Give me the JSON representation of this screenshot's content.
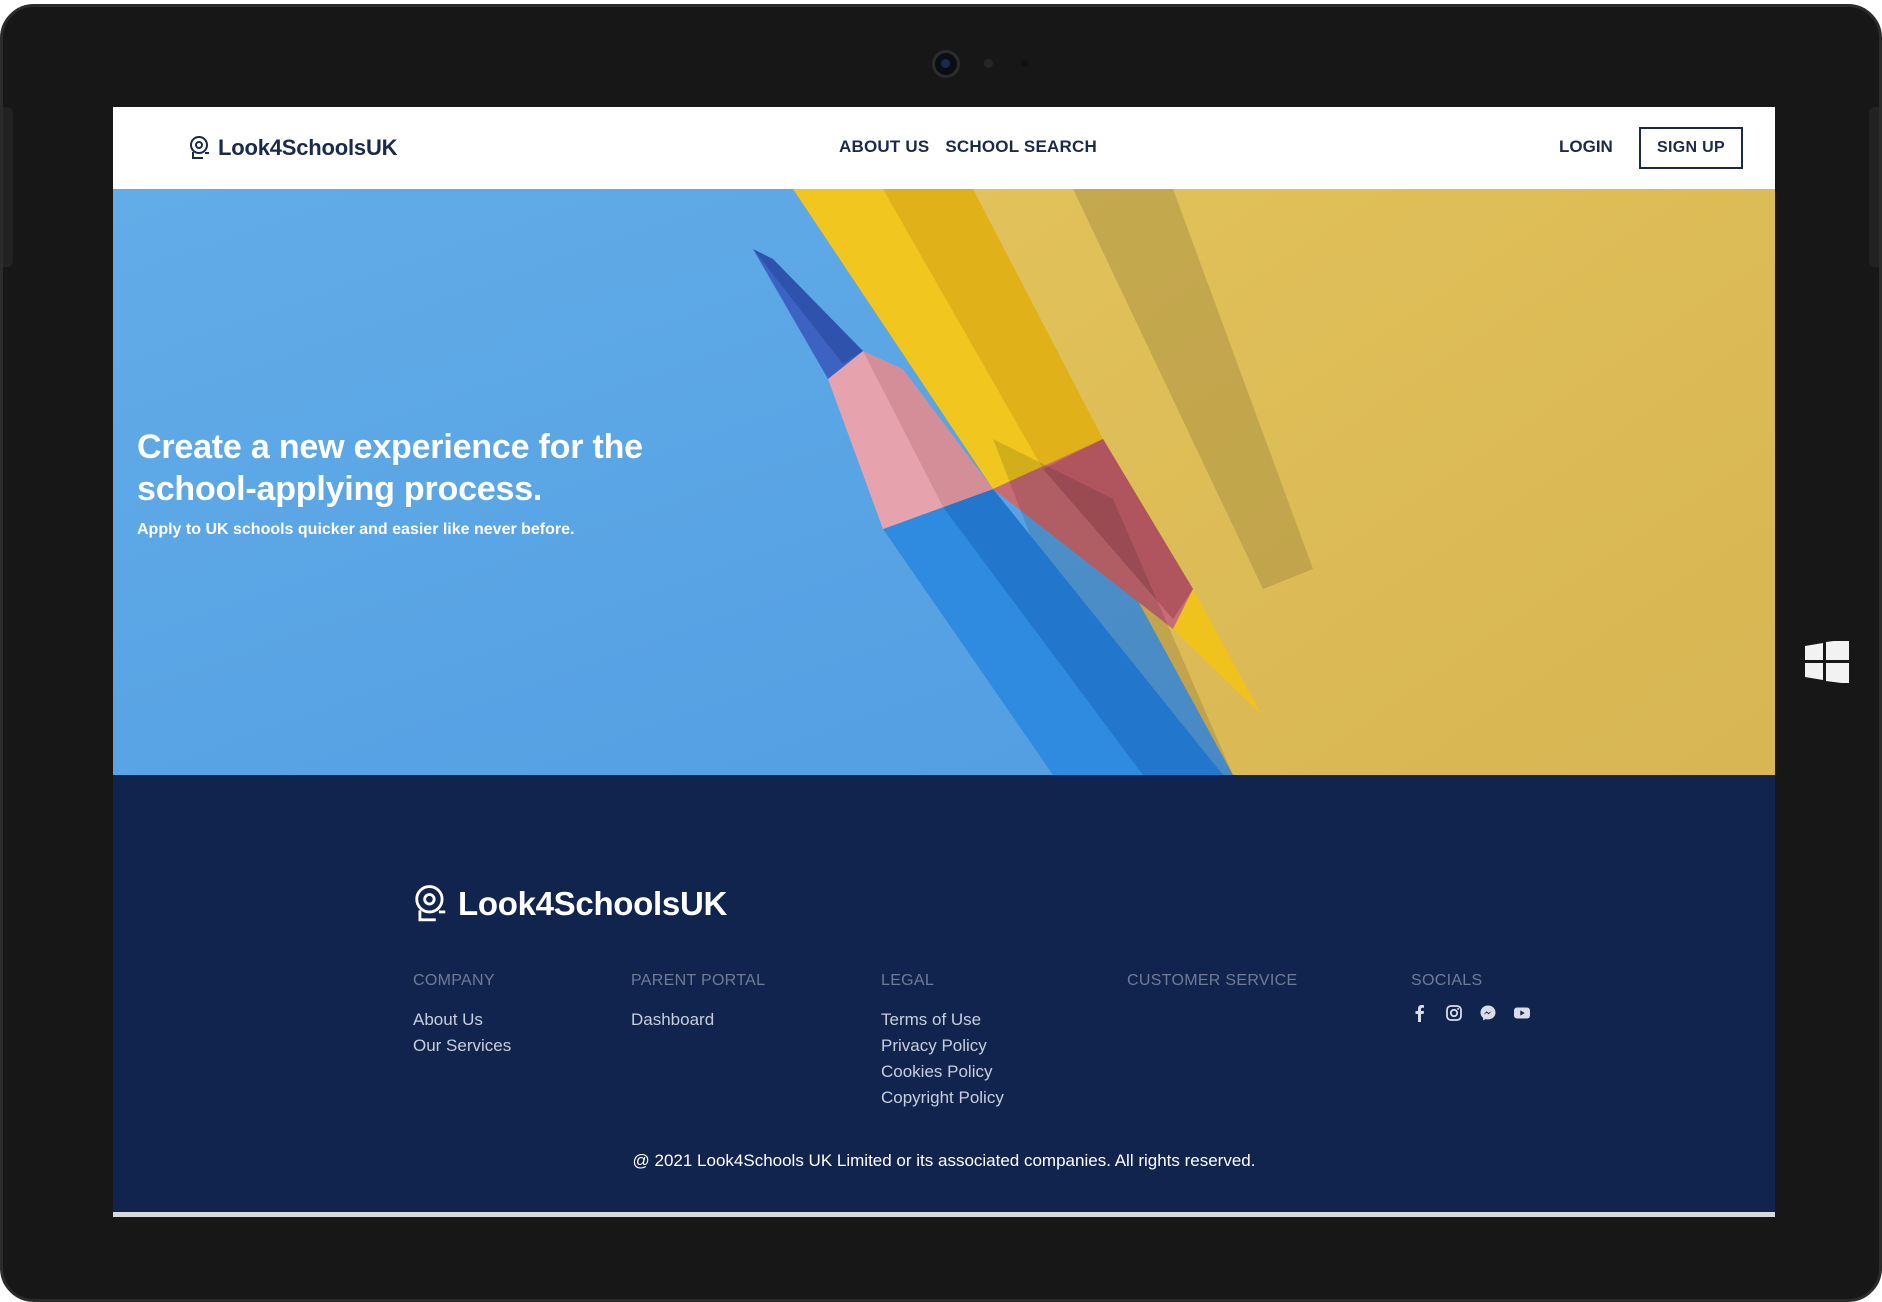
{
  "header": {
    "brand": "Look4SchoolsUK",
    "nav": [
      "ABOUT US",
      "SCHOOL SEARCH"
    ],
    "login": "LOGIN",
    "signup": "SIGN UP"
  },
  "hero": {
    "title": "Create a new experience for the school-applying process.",
    "subtitle": "Apply to UK schools quicker and easier like never before."
  },
  "footer": {
    "brand": "Look4SchoolsUK",
    "columns": [
      {
        "heading": "COMPANY",
        "links": [
          "About Us",
          "Our Services"
        ]
      },
      {
        "heading": "PARENT PORTAL",
        "links": [
          "Dashboard"
        ]
      },
      {
        "heading": "LEGAL",
        "links": [
          "Terms of Use",
          "Privacy Policy",
          "Cookies Policy",
          "Copyright Policy"
        ]
      },
      {
        "heading": "CUSTOMER SERVICE",
        "links": []
      },
      {
        "heading": "SOCIALS",
        "icons": [
          "facebook-icon",
          "instagram-icon",
          "messenger-icon",
          "youtube-icon"
        ]
      }
    ],
    "copyright": "@ 2021 Look4Schools UK Limited or its associated companies. All rights reserved."
  },
  "colors": {
    "navy": "#11244d",
    "sky": "#5aa7e8",
    "mustard": "#dcbd58",
    "white": "#ffffff"
  }
}
